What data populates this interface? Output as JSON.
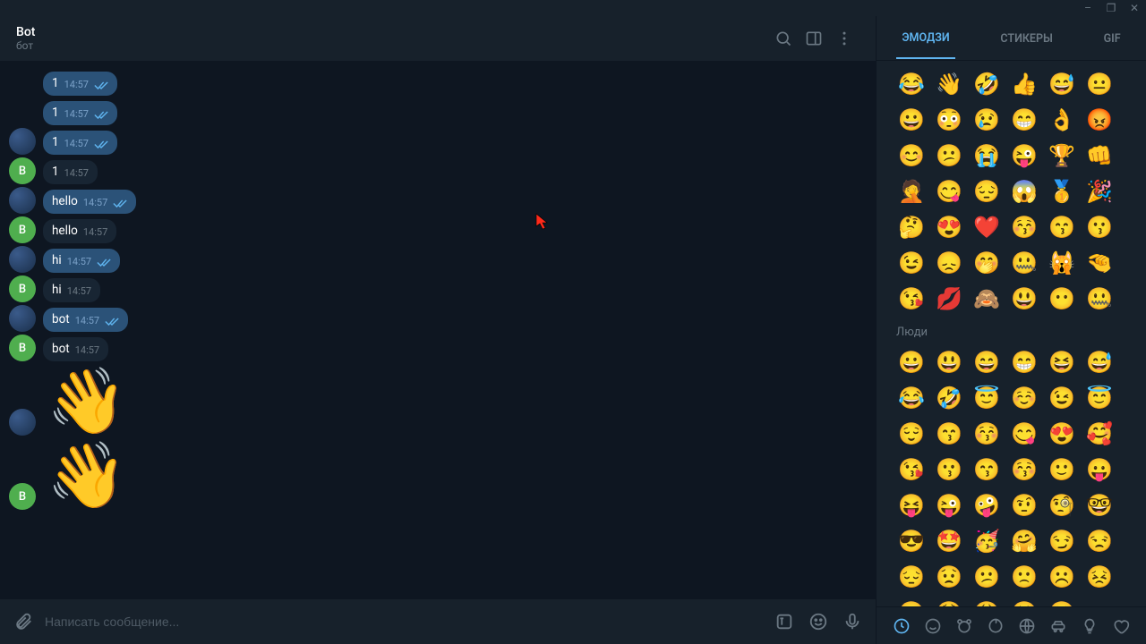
{
  "window": {
    "minimize": "_",
    "maximize": "❐",
    "close": "✕"
  },
  "header": {
    "title": "Bot",
    "subtitle": "бот"
  },
  "messages": [
    {
      "side": "out",
      "avatar": "spacer",
      "text": "1",
      "time": "14:57",
      "read": true
    },
    {
      "side": "out",
      "avatar": "spacer",
      "text": "1",
      "time": "14:57",
      "read": true
    },
    {
      "side": "out",
      "avatar": "me",
      "text": "1",
      "time": "14:57",
      "read": true
    },
    {
      "side": "in",
      "avatar": "bot",
      "text": "1",
      "time": "14:57"
    },
    {
      "side": "out",
      "avatar": "me",
      "text": "hello",
      "time": "14:57",
      "read": true
    },
    {
      "side": "in",
      "avatar": "bot",
      "text": "hello",
      "time": "14:57"
    },
    {
      "side": "out",
      "avatar": "me",
      "text": "hi",
      "time": "14:57",
      "read": true
    },
    {
      "side": "in",
      "avatar": "bot",
      "text": "hi",
      "time": "14:57"
    },
    {
      "side": "out",
      "avatar": "me",
      "text": "bot",
      "time": "14:57",
      "read": true
    },
    {
      "side": "in",
      "avatar": "bot",
      "text": "bot",
      "time": "14:57"
    },
    {
      "side": "out",
      "avatar": "me",
      "emoji": "👋"
    },
    {
      "side": "in",
      "avatar": "bot",
      "emoji": "👋"
    }
  ],
  "avatars": {
    "bot_letter": "B"
  },
  "input": {
    "placeholder": "Написать сообщение..."
  },
  "panel": {
    "tabs": {
      "emoji": "ЭМОДЗИ",
      "stickers": "СТИКЕРЫ",
      "gif": "GIF"
    },
    "recent": [
      "😂",
      "👋",
      "🤣",
      "👍",
      "😅",
      "😐",
      "😀",
      "😳",
      "😢",
      "😁",
      "👌",
      "😡",
      "😊",
      "😕",
      "😭",
      "😜",
      "🏆",
      "👊",
      "🤦",
      "😋",
      "😔",
      "😱",
      "🥇",
      "🎉",
      "🤔",
      "😍",
      "❤️",
      "😚",
      "😙",
      "😗",
      "😉",
      "😞",
      "🤭",
      "🤐",
      "🙀",
      "🤏",
      "😘",
      "💋",
      "🙈",
      "😃",
      "😶",
      "🤐"
    ],
    "section_people_title": "Люди",
    "people": [
      "😀",
      "😃",
      "😄",
      "😁",
      "😆",
      "😅",
      "😂",
      "🤣",
      "😇",
      "☺️",
      "😉",
      "😇",
      "😌",
      "😙",
      "😚",
      "😋",
      "😍",
      "🥰",
      "😘",
      "😗",
      "😙",
      "😚",
      "🙂",
      "😛",
      "😝",
      "😜",
      "🤪",
      "🤨",
      "🧐",
      "🤓",
      "😎",
      "🤩",
      "🥳",
      "🤗",
      "😏",
      "😒",
      "😔",
      "😟",
      "😕",
      "🙁",
      "☹️",
      "😣",
      "😖",
      "😫",
      "😩",
      "🥺",
      "😢"
    ]
  }
}
